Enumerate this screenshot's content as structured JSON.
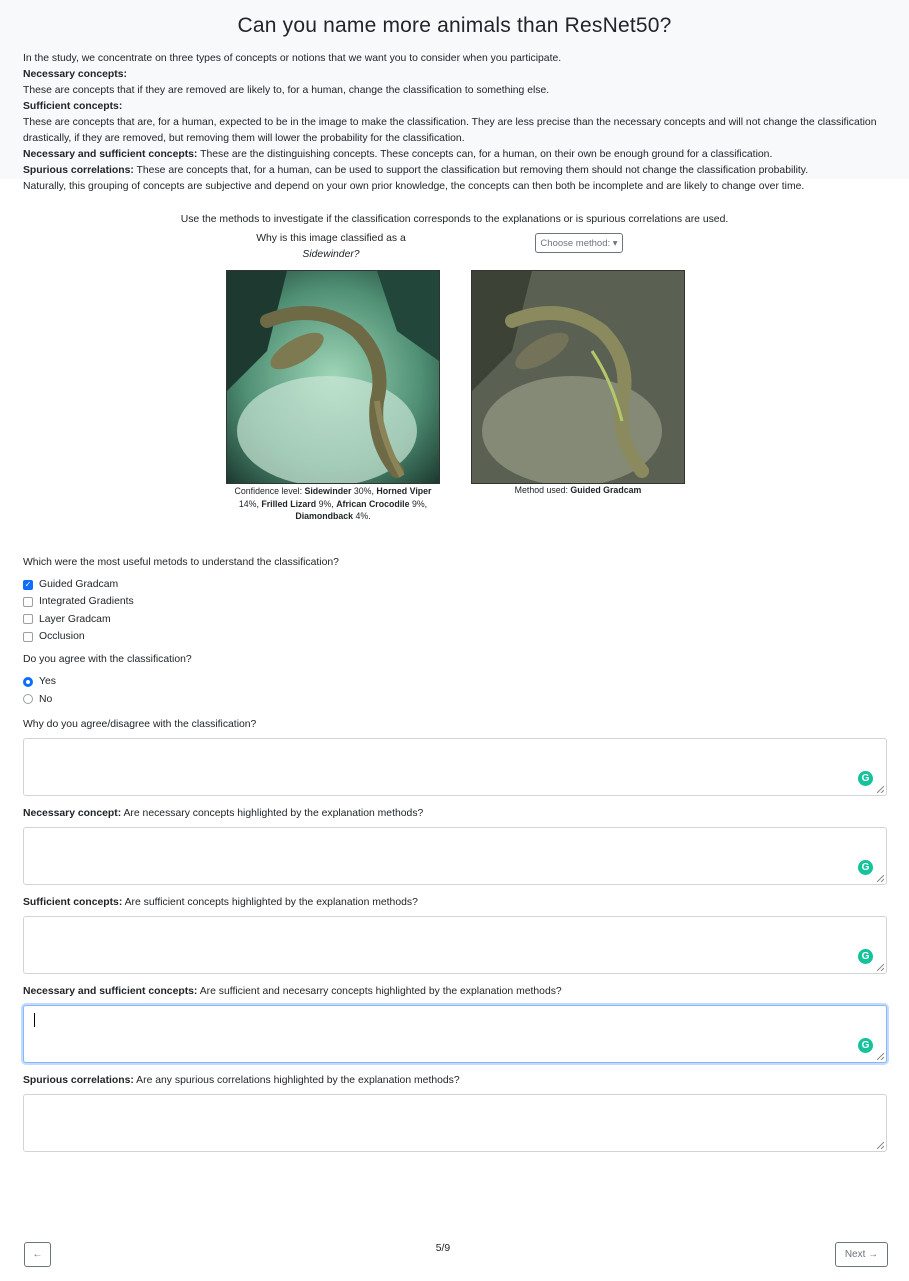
{
  "title": "Can you name more animals than ResNet50?",
  "intro": {
    "lead": "In the study, we concentrate on three types of concepts or notions that we want you to consider when you participate.",
    "necessary_heading": "Necessary concepts:",
    "necessary_text": "These are concepts that if they are removed are likely to, for a human, change the classification to something else.",
    "sufficient_heading": "Sufficient concepts:",
    "sufficient_text": "These are concepts that are, for a human, expected to be in the image to make the classification. They are less precise than the necessary concepts and will not change the classification drastically, if they are removed, but removing them will lower the probability for the classification.",
    "necsuff_heading": "Necessary and sufficient concepts:",
    "necsuff_text": " These are the distinguishing concepts. These concepts can, for a human, on their own be enough ground for a classification.",
    "spurious_heading": "Spurious correlations:",
    "spurious_text": " These are concepts that, for a human, can be used to support the classification but removing them should not change the classification probability.",
    "closing": "Naturally, this grouping of concepts are subjective and depend on your own prior knowledge, the concepts can then both be incomplete and are likely to change over time."
  },
  "instruction": "Use the methods to investigate if the classification corresponds to the explanations or is spurious correlations are used.",
  "question_why": "Why is this image classified as a",
  "class_name": "Sidewinder?",
  "method_button": "Choose method:",
  "confidence": {
    "prefix": "Confidence level: ",
    "items": [
      {
        "label": "Sidewinder",
        "pct": "30%,"
      },
      {
        "label": "Horned Viper",
        "pct": "14%,"
      },
      {
        "label": "Frilled Lizard",
        "pct": "9%,"
      },
      {
        "label": "African Crocodile",
        "pct": "9%,"
      },
      {
        "label": "Diamondback",
        "pct": "4%."
      }
    ]
  },
  "method_used": {
    "prefix": "Method used: ",
    "value": "Guided Gradcam"
  },
  "q_methods": "Which were the most useful metods to understand the classification?",
  "methods": [
    {
      "label": "Guided Gradcam",
      "checked": true
    },
    {
      "label": "Integrated Gradients",
      "checked": false
    },
    {
      "label": "Layer Gradcam",
      "checked": false
    },
    {
      "label": "Occlusion",
      "checked": false
    }
  ],
  "q_agree": "Do you agree with the classification?",
  "agree_options": [
    {
      "label": "Yes",
      "selected": true
    },
    {
      "label": "No",
      "selected": false
    }
  ],
  "q_why_agree": "Why do you agree/disagree with the classification?",
  "q_necessary": {
    "bold": "Necessary concept:",
    "text": " Are necessary concepts highlighted by the explanation methods?"
  },
  "q_sufficient": {
    "bold": "Sufficient concepts:",
    "text": " Are sufficient concepts highlighted by the explanation methods?"
  },
  "q_necsuff": {
    "bold": "Necessary and sufficient concepts:",
    "text": " Are sufficient and necesarry concepts highlighted by the explanation methods?"
  },
  "q_spurious": {
    "bold": "Spurious correlations:",
    "text": " Are any spurious correlations highlighted by the explanation methods?"
  },
  "nav": {
    "prev": "←",
    "page": "5/9",
    "next": "Next →"
  },
  "colors": {
    "accent": "#0d6efd",
    "grammarly": "#15c39a"
  }
}
